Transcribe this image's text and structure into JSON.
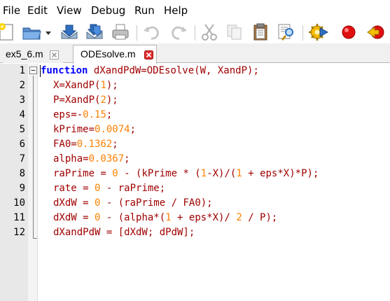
{
  "menu": {
    "items": [
      {
        "label": "File"
      },
      {
        "label": "Edit"
      },
      {
        "label": "View"
      },
      {
        "label": "Debug"
      },
      {
        "label": "Run"
      },
      {
        "label": "Help"
      }
    ]
  },
  "toolbar": {
    "icons": [
      "new-file-icon",
      "open-folder-icon",
      "dropdown-arrow-icon",
      "save-icon",
      "save-all-icon",
      "print-icon",
      "undo-icon",
      "redo-icon",
      "cut-icon",
      "copy-icon",
      "paste-icon",
      "find-icon",
      "compile-icon",
      "run-stop-icon",
      "breakpoint-icon"
    ]
  },
  "tabs": [
    {
      "label": "ex5_6.m",
      "active": false
    },
    {
      "label": "ODEsolve.m",
      "active": true
    }
  ],
  "editor": {
    "line_numbers": [
      "1",
      "2",
      "3",
      "4",
      "5",
      "6",
      "7",
      "8",
      "9",
      "10",
      "11",
      "12"
    ],
    "lines": [
      [
        {
          "t": "function",
          "c": "kw"
        },
        {
          "t": " dXandPdW=ODEsolve(W, XandP);",
          "c": "op"
        }
      ],
      [
        {
          "t": "X=XandP(",
          "c": "op"
        },
        {
          "t": "1",
          "c": "num"
        },
        {
          "t": ");",
          "c": "op"
        }
      ],
      [
        {
          "t": "P=XandP(",
          "c": "op"
        },
        {
          "t": "2",
          "c": "num"
        },
        {
          "t": ");",
          "c": "op"
        }
      ],
      [
        {
          "t": "eps=-",
          "c": "op"
        },
        {
          "t": "0.15",
          "c": "num"
        },
        {
          "t": ";",
          "c": "op"
        }
      ],
      [
        {
          "t": "kPrime=",
          "c": "op"
        },
        {
          "t": "0.0074",
          "c": "num"
        },
        {
          "t": ";",
          "c": "op"
        }
      ],
      [
        {
          "t": "FA0=",
          "c": "op"
        },
        {
          "t": "0.1362",
          "c": "num"
        },
        {
          "t": ";",
          "c": "op"
        }
      ],
      [
        {
          "t": "alpha=",
          "c": "op"
        },
        {
          "t": "0.0367",
          "c": "num"
        },
        {
          "t": ";",
          "c": "op"
        }
      ],
      [
        {
          "t": "raPrime = ",
          "c": "op"
        },
        {
          "t": "0",
          "c": "num"
        },
        {
          "t": " - (kPrime * (",
          "c": "op"
        },
        {
          "t": "1",
          "c": "num"
        },
        {
          "t": "-X)/(",
          "c": "op"
        },
        {
          "t": "1",
          "c": "num"
        },
        {
          "t": " + eps*X)*P);",
          "c": "op"
        }
      ],
      [
        {
          "t": "rate = ",
          "c": "op"
        },
        {
          "t": "0",
          "c": "num"
        },
        {
          "t": " - raPrime;",
          "c": "op"
        }
      ],
      [
        {
          "t": "dXdW = ",
          "c": "op"
        },
        {
          "t": "0",
          "c": "num"
        },
        {
          "t": " - (raPrime / FA0);",
          "c": "op"
        }
      ],
      [
        {
          "t": "dXdW = ",
          "c": "op"
        },
        {
          "t": "0",
          "c": "num"
        },
        {
          "t": " - (alpha*(",
          "c": "op"
        },
        {
          "t": "1",
          "c": "num"
        },
        {
          "t": " + eps*X)/ ",
          "c": "op"
        },
        {
          "t": "2",
          "c": "num"
        },
        {
          "t": " / P);",
          "c": "op"
        }
      ],
      [
        {
          "t": "dXandPdW = [dXdW; dPdW];",
          "c": "op"
        }
      ]
    ]
  },
  "colors": {
    "keyword": "#0000ff",
    "number": "#ff8000",
    "operator": "#a00000",
    "gutter": "#e8e8e8"
  }
}
